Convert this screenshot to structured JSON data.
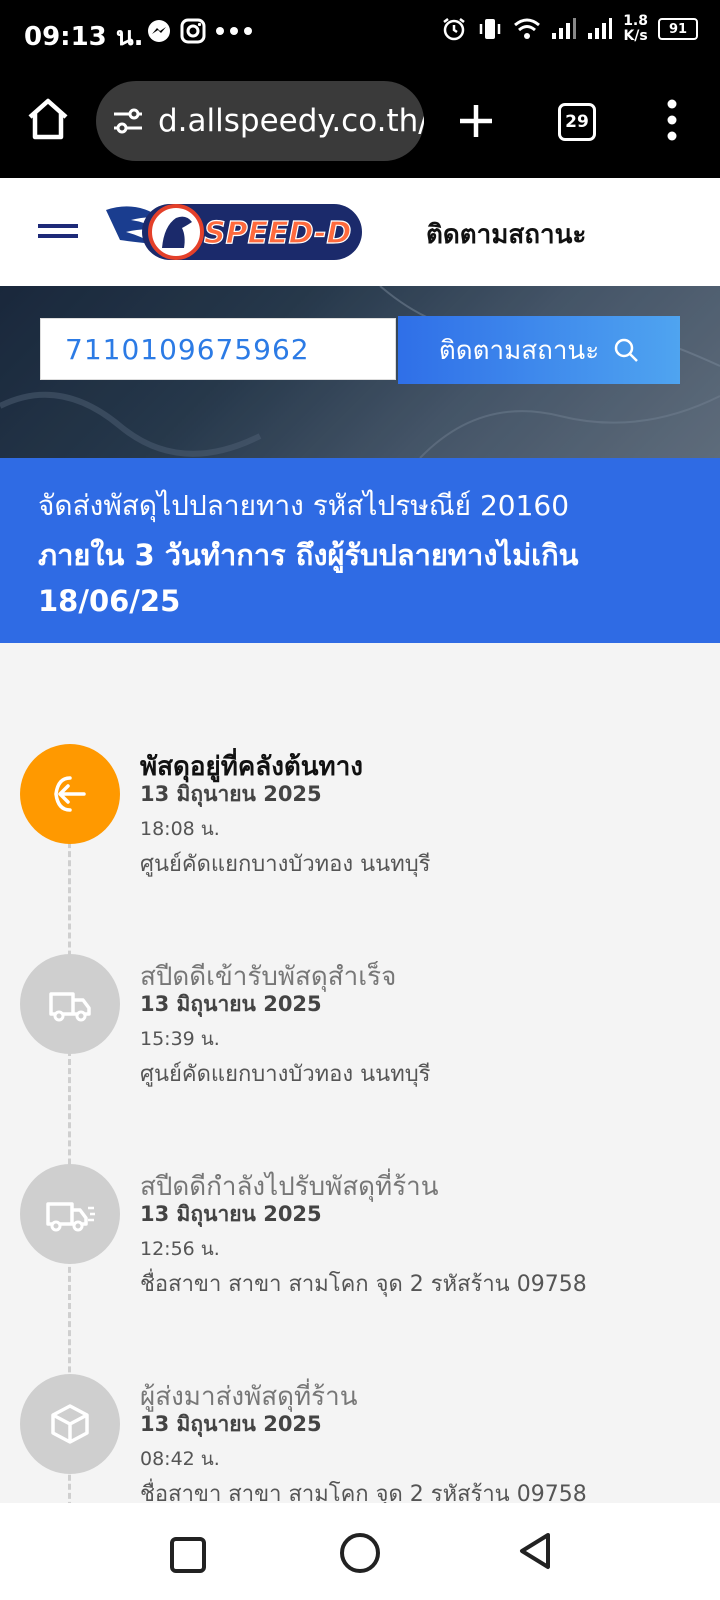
{
  "status_bar": {
    "time": "09:13 น.",
    "left_icons": [
      "messenger-icon",
      "instagram-icon",
      "more-dots-icon"
    ],
    "right_icons": [
      "alarm-icon",
      "vibrate-icon",
      "wifi-icon",
      "signal-icon",
      "signal-icon"
    ],
    "net_speed_value": "1.8",
    "net_speed_unit": "K/s",
    "battery": "91"
  },
  "browser": {
    "url": "d.allspeedy.co.th/",
    "tab_count": "29",
    "icons": [
      "home-icon",
      "site-settings-icon",
      "plus-icon",
      "tabs-icon",
      "overflow-menu-icon"
    ]
  },
  "header": {
    "logo_text": "SPEED-D",
    "nav_title": "ติดตามสถานะ"
  },
  "search": {
    "tracking_number": "7110109675962",
    "button_label": "ติดตามสถานะ"
  },
  "banner": {
    "line1": "จัดส่งพัสดุไปปลายทาง รหัสไปรษณีย์ 20160",
    "line2": "ภายใน 3 วันทำการ ถึงผู้รับปลายทางไม่เกิน 18/06/25"
  },
  "timeline": [
    {
      "title": "พัสดุอยู่ที่คลังต้นทาง",
      "date": "13 มิถุนายน 2025",
      "time": "18:08 น.",
      "location": "ศูนย์คัดแยกบางบัวทอง นนทบุรี",
      "icon": "warehouse-arrow-icon",
      "active": true
    },
    {
      "title": "สปีดดีเข้ารับพัสดุสำเร็จ",
      "date": "13 มิถุนายน 2025",
      "time": "15:39 น.",
      "location": "ศูนย์คัดแยกบางบัวทอง นนทบุรี",
      "icon": "truck-icon",
      "active": false
    },
    {
      "title": "สปีดดีกำลังไปรับพัสดุที่ร้าน",
      "date": "13 มิถุนายน 2025",
      "time": "12:56 น.",
      "location": "ชื่อสาขา สาขา สามโคก จุด 2 รหัสร้าน 09758",
      "icon": "fast-truck-icon",
      "active": false
    },
    {
      "title": "ผู้ส่งมาส่งพัสดุที่ร้าน",
      "date": "13 มิถุนายน 2025",
      "time": "08:42 น.",
      "location": "ชื่อสาขา สาขา สามโคก จุด 2 รหัสร้าน 09758",
      "icon": "package-box-icon",
      "active": false
    }
  ],
  "colors": {
    "accent_blue": "#2f6be4",
    "active_orange": "#ff9900",
    "inactive_gray": "#cfcfcf"
  }
}
